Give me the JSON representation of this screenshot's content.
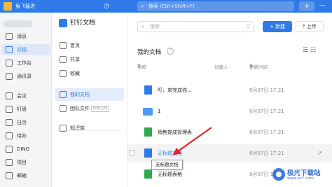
{
  "topbar": {
    "user_name": "兔飞猛进",
    "search_placeholder": "搜索 (Ctrl+Shift+F)",
    "plus_label": "+",
    "minimize_label": "—"
  },
  "rail": {
    "items": [
      {
        "label": "消息"
      },
      {
        "label": "文档"
      },
      {
        "label": "工作台"
      },
      {
        "label": "通讯录"
      },
      {
        "label": "会议"
      },
      {
        "label": "钉盘"
      },
      {
        "label": "日历"
      },
      {
        "label": "待办"
      },
      {
        "label": "DING"
      },
      {
        "label": "项目"
      },
      {
        "label": "邮箱"
      }
    ]
  },
  "nav": {
    "title": "钉钉文档",
    "items": [
      {
        "label": "首页"
      },
      {
        "label": "共享"
      },
      {
        "label": "收藏"
      },
      {
        "label": "我的文档"
      },
      {
        "label": "团队文件"
      },
      {
        "label": "知识库"
      }
    ],
    "team_badge": "即将上线"
  },
  "main": {
    "search_placeholder": "搜索",
    "new_button": "+ 新建",
    "upload_button": "上传",
    "section_title": "我的文档",
    "columns": {
      "name": "名称",
      "creator": "创建人",
      "mtime": "更新时间"
    },
    "rows": [
      {
        "type": "doc",
        "name": "叮，来完成你…",
        "creator": "",
        "mtime": "8月07日 17:21"
      },
      {
        "type": "folder",
        "name": "1",
        "creator": "",
        "mtime": "8月07日 17:21"
      },
      {
        "type": "sheet",
        "name": "销售提成管理表",
        "creator": "",
        "mtime": "8月07日 17:21"
      },
      {
        "type": "doc",
        "name": "无标题文档",
        "creator": "",
        "mtime": "8月07日 17:21"
      },
      {
        "type": "sheet",
        "name": "无标题表格",
        "creator": "",
        "mtime": "8月07日 17:21"
      }
    ],
    "tooltip": "无标题文档"
  },
  "watermark": {
    "text": "极光下载站",
    "url": "www.xz7.com"
  },
  "colors": {
    "accent": "#2f7ae8",
    "sheet": "#2fa84f",
    "arrow": "#d9282f"
  }
}
